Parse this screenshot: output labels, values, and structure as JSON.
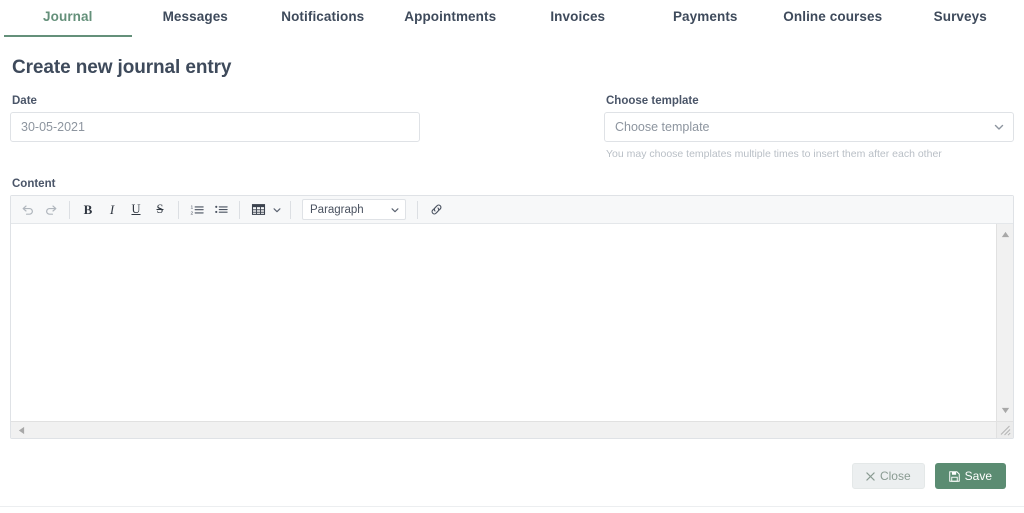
{
  "tabs": [
    {
      "label": "Journal",
      "active": true
    },
    {
      "label": "Messages",
      "active": false
    },
    {
      "label": "Notifications",
      "active": false
    },
    {
      "label": "Appointments",
      "active": false
    },
    {
      "label": "Invoices",
      "active": false
    },
    {
      "label": "Payments",
      "active": false
    },
    {
      "label": "Online courses",
      "active": false
    },
    {
      "label": "Surveys",
      "active": false
    }
  ],
  "page": {
    "title": "Create new journal entry"
  },
  "date_field": {
    "label": "Date",
    "value": "30-05-2021",
    "placeholder": "30-05-2021"
  },
  "template_field": {
    "label": "Choose template",
    "selected": "Choose template",
    "helper": "You may choose templates multiple times to insert them after each other",
    "chevron_icon": "chevron-down-icon"
  },
  "content_field": {
    "label": "Content",
    "value": "",
    "toolbar": {
      "undo": {
        "name": "undo-icon",
        "title": "Undo"
      },
      "redo": {
        "name": "redo-icon",
        "title": "Redo"
      },
      "bold": {
        "name": "bold-icon",
        "glyph": "B",
        "title": "Bold"
      },
      "italic": {
        "name": "italic-icon",
        "glyph": "I",
        "title": "Italic"
      },
      "underline": {
        "name": "underline-icon",
        "glyph": "U",
        "title": "Underline"
      },
      "strikethrough": {
        "name": "strikethrough-icon",
        "glyph": "S",
        "title": "Strikethrough"
      },
      "ordered_list": {
        "name": "ordered-list-icon",
        "title": "Ordered list"
      },
      "bullet_list": {
        "name": "bullet-list-icon",
        "title": "Bullet list"
      },
      "table": {
        "name": "table-icon",
        "title": "Table"
      },
      "table_caret": {
        "name": "chevron-down-icon",
        "title": "Table options"
      },
      "format_select": {
        "name": "format-select",
        "value": "Paragraph",
        "caret_icon": "chevron-down-icon"
      },
      "link": {
        "name": "link-icon",
        "title": "Insert link"
      }
    },
    "scrollbars": {
      "vertical_up_icon": "scroll-up-arrow-icon",
      "vertical_down_icon": "scroll-down-arrow-icon",
      "horizontal_left_icon": "scroll-left-arrow-icon",
      "resize_grip": "resize-grip-handle"
    }
  },
  "footer": {
    "close": {
      "label": "Close",
      "icon": "close-x-icon"
    },
    "save": {
      "label": "Save",
      "icon": "floppy-disk-save-icon"
    }
  },
  "colors": {
    "accent_green": "#5b8c72",
    "tab_active": "#64907a",
    "text_dark": "#3e4a5b",
    "text_muted": "#8d959f",
    "helper_muted": "#b9bfc6",
    "border": "#dfe2e6",
    "toolbar_bg": "#f7f8f9",
    "close_btn_bg": "#eceff0"
  }
}
